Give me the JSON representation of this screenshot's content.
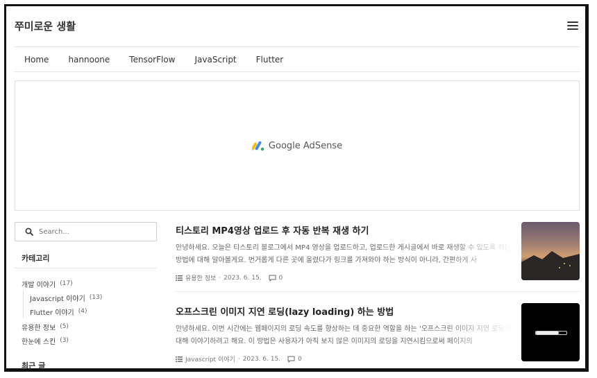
{
  "site": {
    "title": "쭈미로운 생활"
  },
  "nav": {
    "items": [
      {
        "label": "Home"
      },
      {
        "label": "hannoone"
      },
      {
        "label": "TensorFlow"
      },
      {
        "label": "JavaScript"
      },
      {
        "label": "Flutter"
      }
    ]
  },
  "ad": {
    "text": "Google AdSense"
  },
  "search": {
    "placeholder": "Search..."
  },
  "sidebar": {
    "category_title": "카테고리",
    "categories": [
      {
        "label": "개발 이야기",
        "count": "(17)"
      },
      {
        "label": "Javascript 이야기",
        "count": "(13)"
      },
      {
        "label": "Flutter 이야기",
        "count": "(4)"
      },
      {
        "label": "유용한 정보",
        "count": "(5)"
      },
      {
        "label": "한눈에 스킨",
        "count": "(3)"
      }
    ],
    "recent_title": "최근 글"
  },
  "posts": [
    {
      "title": "티스토리 MP4영상 업로드 후 자동 반복 재생 하기",
      "excerpt": "안녕하세요. 오늘은 티스토리 블로그에서 MP4 영상을 업로드하고, 업로드한 게시글에서 바로 재생할 수 있도록 하는 방법에 대해 알아볼게요. 번거롭게 다른 곳에 올렸다가 링크를 가져와야 하는 방식이 아니라, 간편하게 사",
      "category": "유용한 정보",
      "date": "2023. 6. 15.",
      "comments": "0"
    },
    {
      "title": "오프스크린 이미지 지연 로딩(lazy loading) 하는 방법",
      "excerpt": "안녕하세요. 이번 시간에는 웹페이지의 로딩 속도를 향상하는 데 중요한 역할을 하는 '오프스크린 이미지 지연 로딩'에 대해 이야기하려고 해요. 이 방법은 사용자가 아직 보지 않은 이미지의 로딩을 지연시킴으로써 페이지의",
      "category": "Javascript 이야기",
      "date": "2023. 6. 15.",
      "comments": "0",
      "thumb_progress": 0.75
    }
  ]
}
